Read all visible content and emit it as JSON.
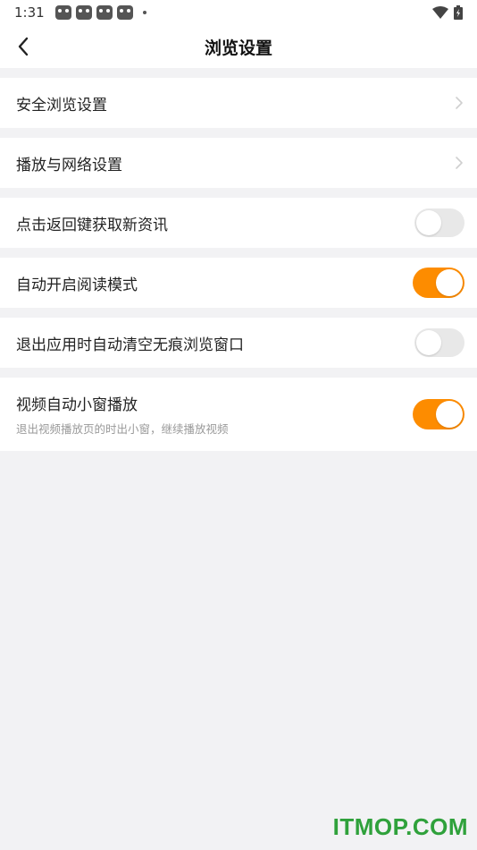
{
  "status_bar": {
    "time": "1:31",
    "notification_icons": [
      "app-notification-icon",
      "app-notification-icon",
      "app-notification-icon",
      "app-notification-icon"
    ],
    "icons": [
      "wifi-icon",
      "battery-icon"
    ]
  },
  "header": {
    "title": "浏览设置",
    "back_icon": "back-arrow-icon"
  },
  "settings": [
    {
      "label": "安全浏览设置",
      "control": "chevron"
    },
    {
      "label": "播放与网络设置",
      "control": "chevron"
    },
    {
      "label": "点击返回键获取新资讯",
      "control": "toggle",
      "state": "off"
    },
    {
      "label": "自动开启阅读模式",
      "control": "toggle",
      "state": "on"
    },
    {
      "label": "退出应用时自动清空无痕浏览窗口",
      "control": "toggle",
      "state": "off"
    },
    {
      "label": "视频自动小窗播放",
      "sublabel": "退出视频播放页的时出小窗，继续播放视频",
      "control": "toggle",
      "state": "on"
    }
  ],
  "colors": {
    "accent": "#fd8c00",
    "toggle_off": "#e8e8e8",
    "background": "#f2f2f4"
  },
  "watermark": "ITMOP.COM"
}
